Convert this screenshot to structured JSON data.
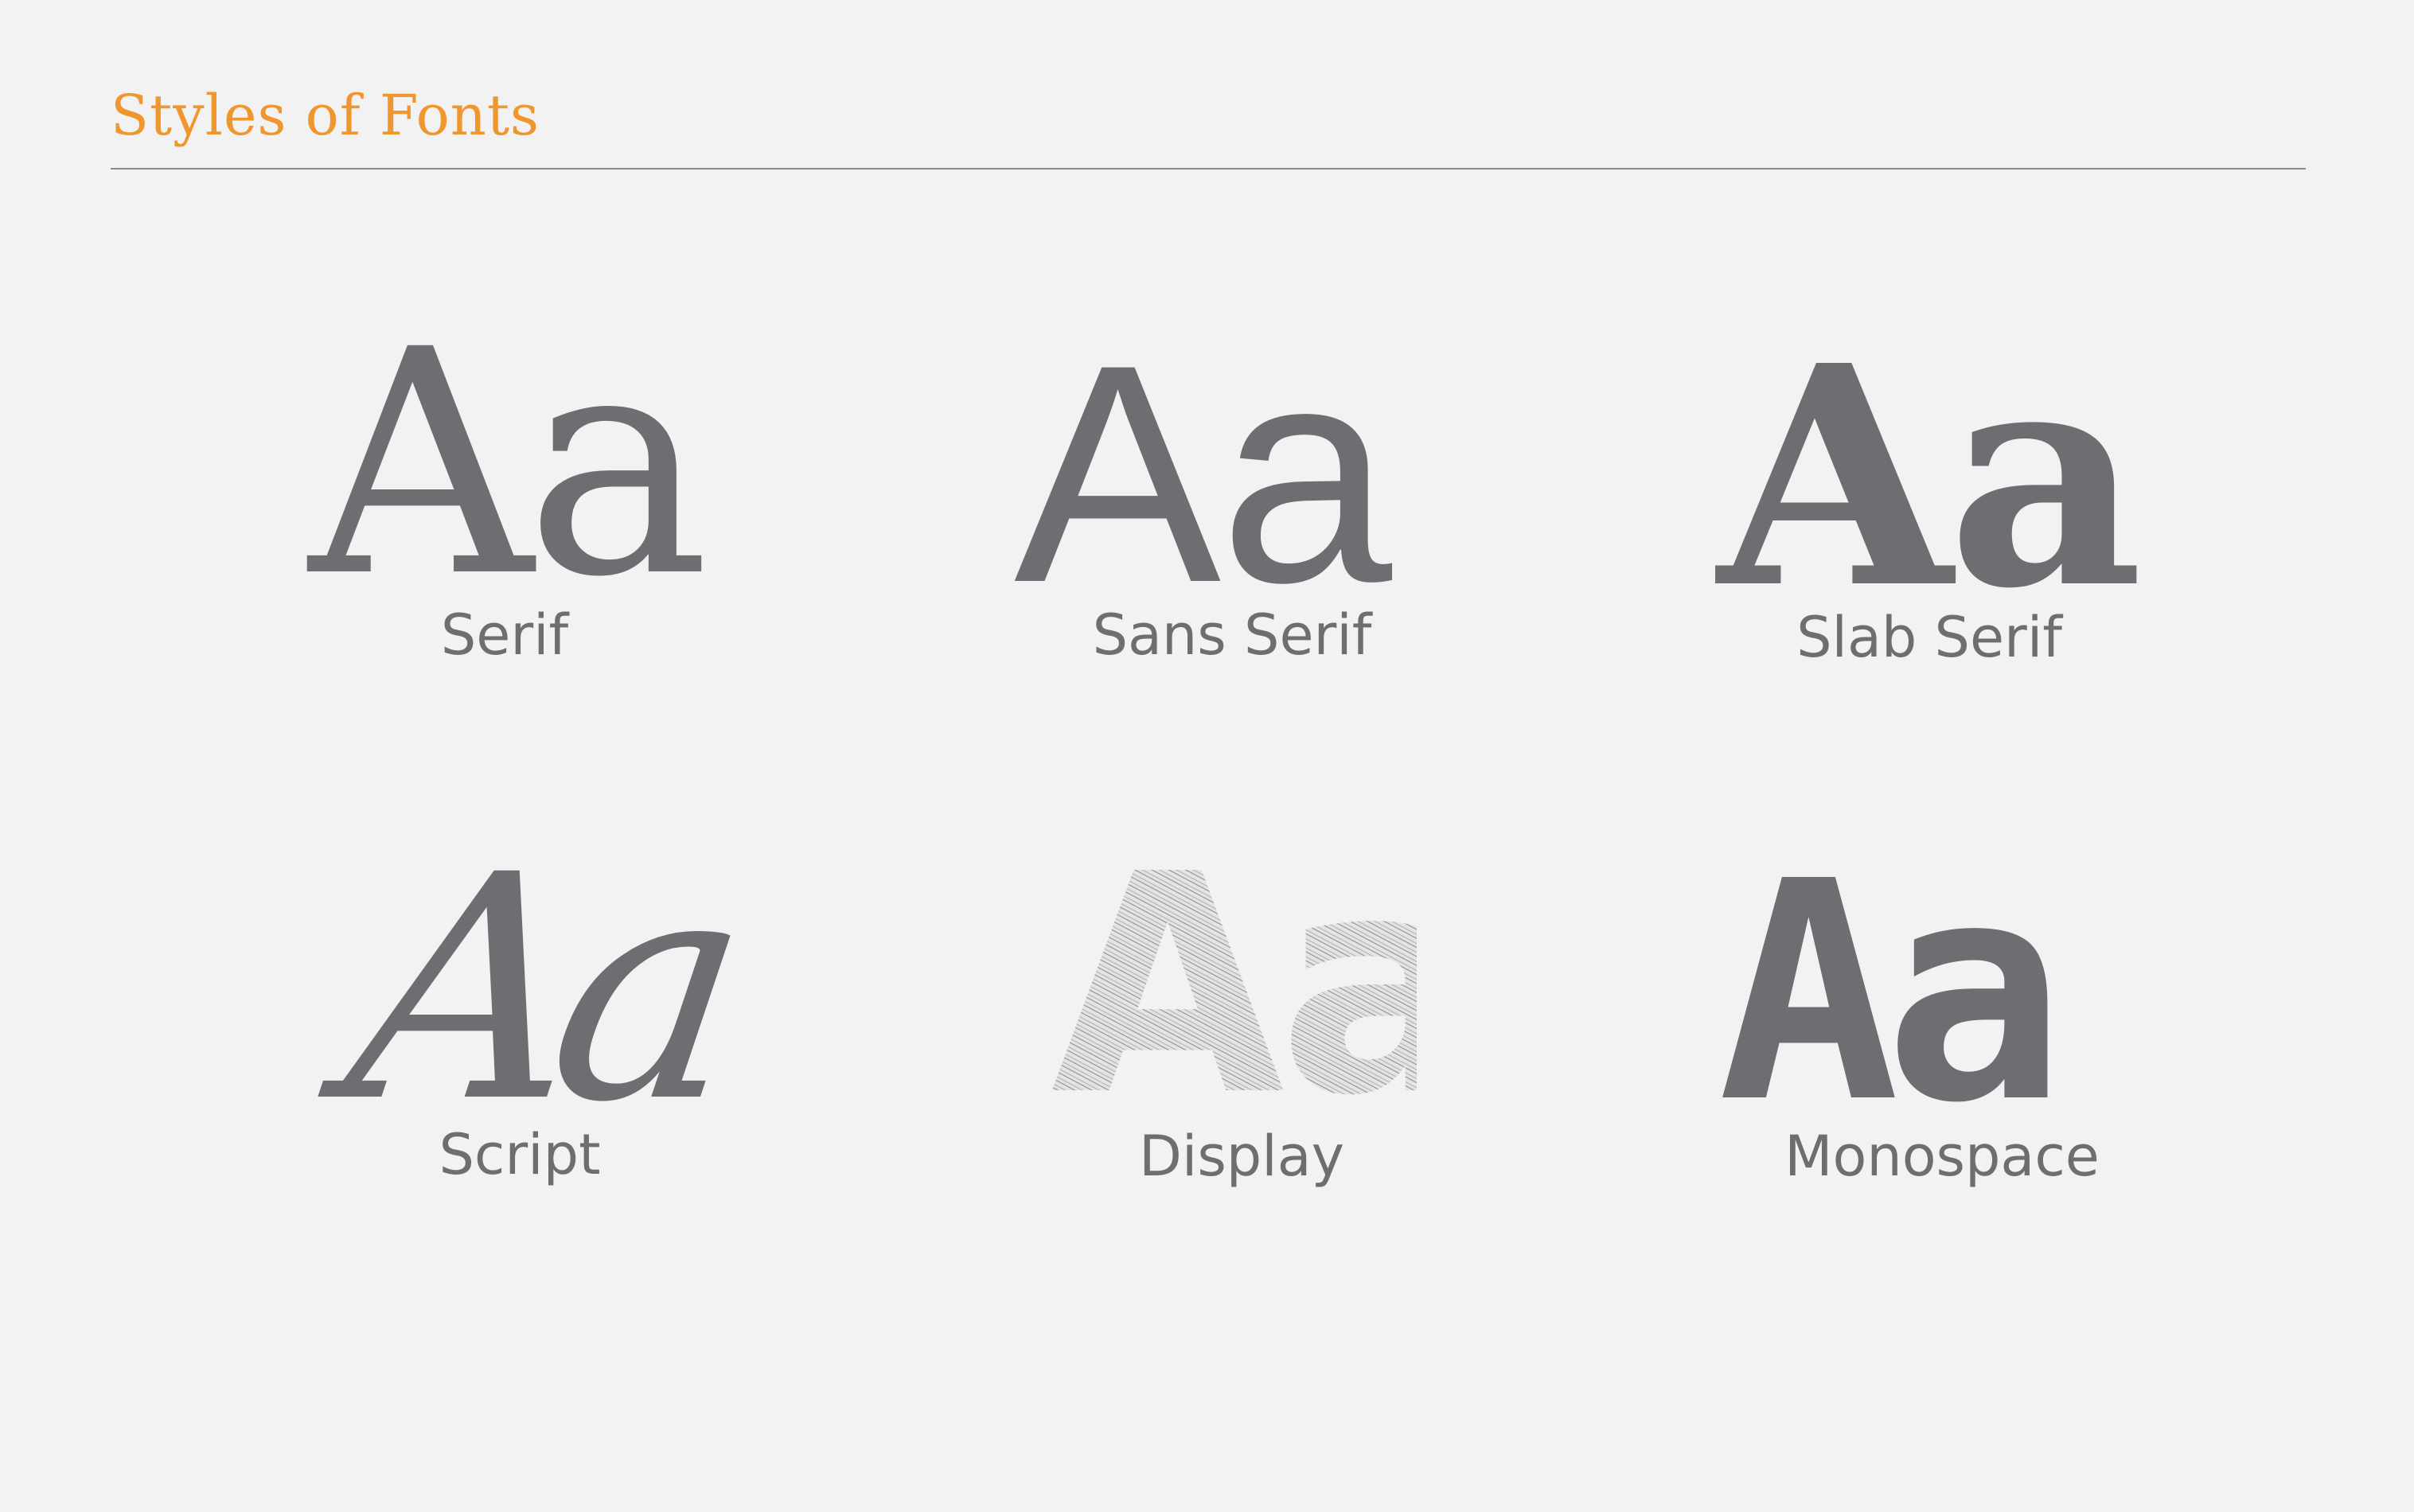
{
  "title": "Styles of Fonts",
  "accent_color": "#f0962e",
  "text_color": "#6d6e71",
  "background_color": "#f2f2f2",
  "styles": [
    {
      "specimen": "Aa",
      "label": "Serif"
    },
    {
      "specimen": "Aa",
      "label": "Sans Serif"
    },
    {
      "specimen": "Aa",
      "label": "Slab Serif"
    },
    {
      "specimen": "Aa",
      "label": "Script"
    },
    {
      "specimen": "Aa",
      "label": "Display"
    },
    {
      "specimen": "Aa",
      "label": "Monospace"
    }
  ]
}
